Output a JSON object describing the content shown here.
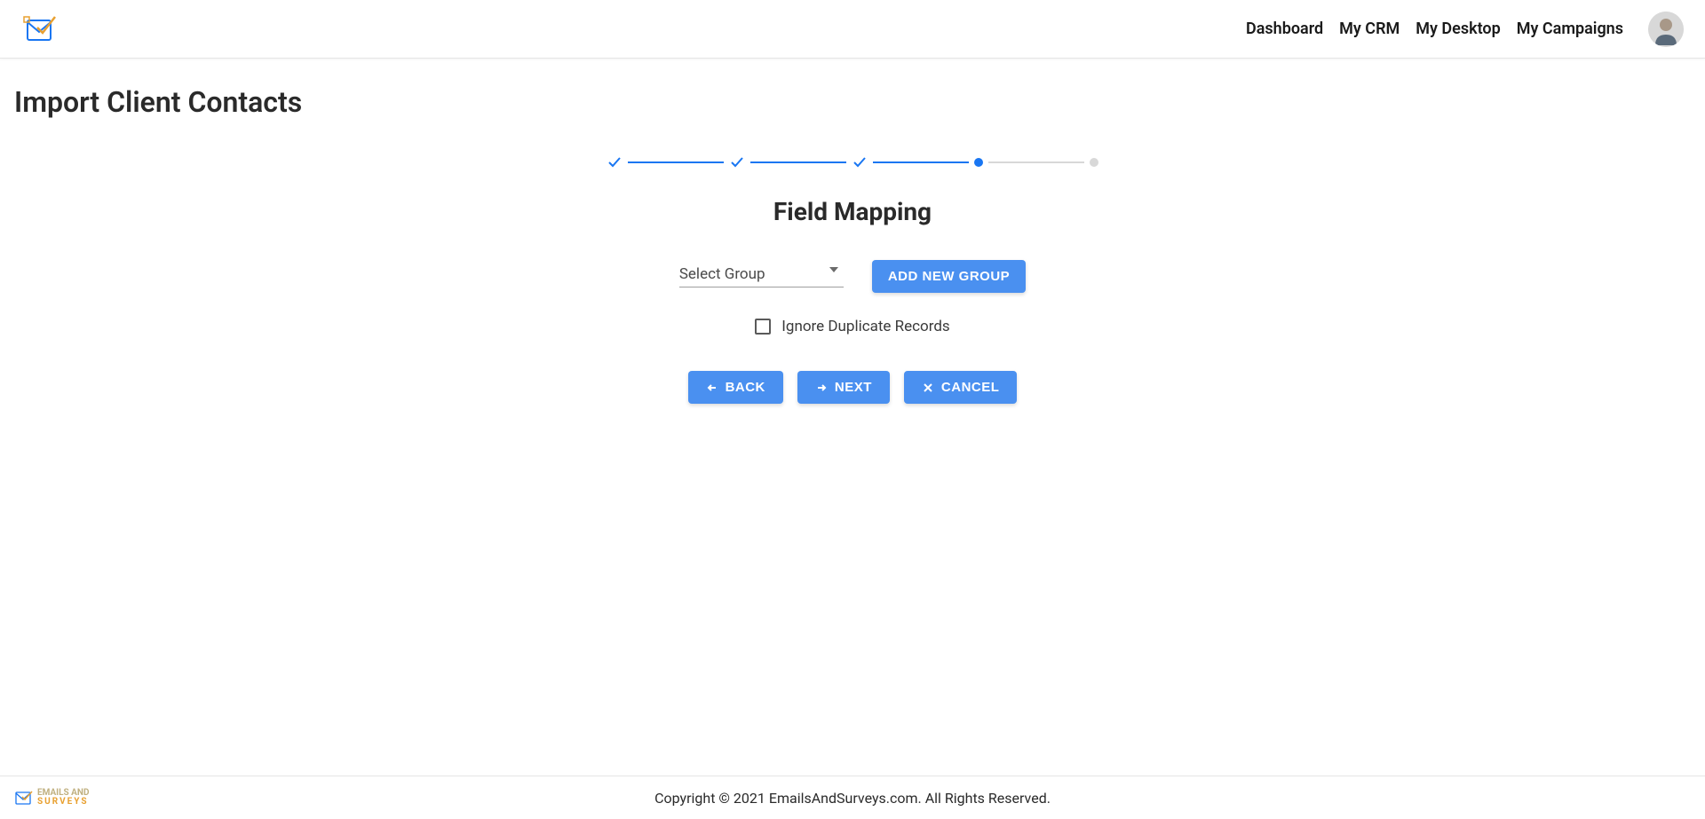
{
  "nav": {
    "dashboard": "Dashboard",
    "myCrm": "My CRM",
    "myDesktop": "My Desktop",
    "myCampaigns": "My Campaigns"
  },
  "page": {
    "title": "Import Client Contacts"
  },
  "section": {
    "title": "Field Mapping"
  },
  "form": {
    "selectGroup": "Select Group",
    "addNewGroup": "ADD NEW GROUP",
    "ignoreDuplicates": "Ignore Duplicate Records"
  },
  "buttons": {
    "back": "BACK",
    "next": "NEXT",
    "cancel": "CANCEL"
  },
  "footer": {
    "brandEmails": "EMAILS",
    "brandAnd": " AND",
    "brandSurveys": "SURVEYS",
    "copyright": "Copyright © 2021 EmailsAndSurveys.com. All Rights Reserved."
  }
}
